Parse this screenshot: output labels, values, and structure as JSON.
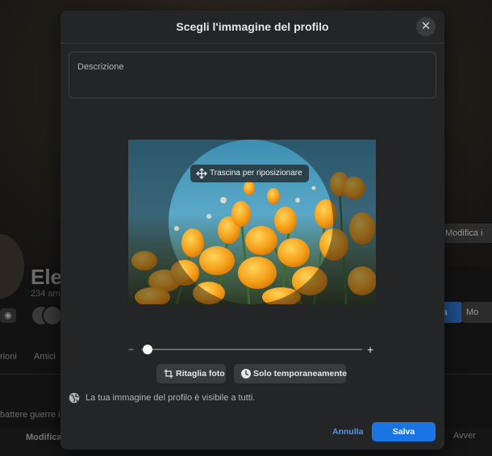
{
  "background": {
    "profile_name": "Elen",
    "friends_count": "234 am",
    "tabs": [
      "rioni",
      "Amici"
    ],
    "post_text": "battere guerre in",
    "edit_cover_label": "Modifica i",
    "edit_label": "Modifica",
    "action_label": "ia",
    "more_label": "Mo",
    "notice_label": "Avver"
  },
  "modal": {
    "title": "Scegli l'immagine del profilo",
    "close_icon": "close-icon",
    "description_placeholder": "Descrizione",
    "description_value": "",
    "drag_hint": "Trascina per riposizionare",
    "zoom": {
      "min_label": "−",
      "max_label": "+",
      "level": 0.03
    },
    "crop_button": "Ritaglia foto",
    "temporary_button": "Solo temporaneamente",
    "visibility_text": "La tua immagine del profilo è visibile a tutti.",
    "cancel_label": "Annulla",
    "save_label": "Salva"
  },
  "colors": {
    "modal_bg": "#242526",
    "accent": "#1b74e4",
    "link": "#4599ff",
    "flower": "#f5a623"
  }
}
